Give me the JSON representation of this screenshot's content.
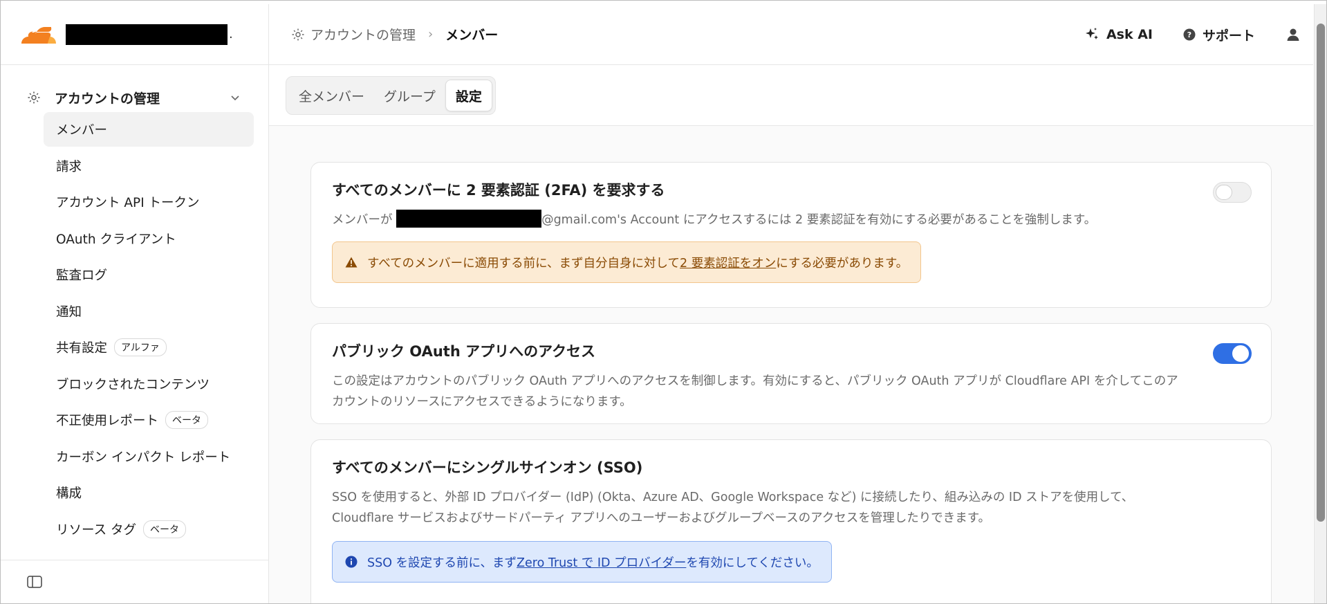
{
  "sidebar": {
    "account_suffix": ".",
    "group_label": "アカウントの管理",
    "items": [
      {
        "label": "メンバー",
        "badge": ""
      },
      {
        "label": "請求",
        "badge": ""
      },
      {
        "label": "アカウント API トークン",
        "badge": ""
      },
      {
        "label": "OAuth クライアント",
        "badge": ""
      },
      {
        "label": "監査ログ",
        "badge": ""
      },
      {
        "label": "通知",
        "badge": ""
      },
      {
        "label": "共有設定",
        "badge": "アルファ"
      },
      {
        "label": "ブロックされたコンテンツ",
        "badge": ""
      },
      {
        "label": "不正使用レポート",
        "badge": "ベータ"
      },
      {
        "label": "カーボン インパクト レポート",
        "badge": ""
      },
      {
        "label": "構成",
        "badge": ""
      },
      {
        "label": "リソース タグ",
        "badge": "ベータ"
      }
    ]
  },
  "breadcrumb": {
    "parent": "アカウントの管理",
    "separator": "›",
    "current": "メンバー"
  },
  "topbar": {
    "ask_ai": "Ask AI",
    "support": "サポート"
  },
  "tabs": [
    {
      "label": "全メンバー"
    },
    {
      "label": "グループ"
    },
    {
      "label": "設定"
    }
  ],
  "cards": {
    "twofa": {
      "title": "すべてのメンバーに 2 要素認証 (2FA) を要求する",
      "desc_prefix": "メンバーが ",
      "desc_suffix": "@gmail.com's Account にアクセスするには 2 要素認証を有効にする必要があることを強制します。",
      "warn_prefix": "すべてのメンバーに適用する前に、まず自分自身に対して ",
      "warn_link": "2 要素認証をオン",
      "warn_suffix": "にする必要があります。",
      "enabled": false
    },
    "oauth": {
      "title": "パブリック OAuth アプリへのアクセス",
      "desc": "この設定はアカウントのパブリック OAuth アプリへのアクセスを制御します。有効にすると、パブリック OAuth アプリが Cloudflare API を介してこのアカウントのリソースにアクセスできるようになります。",
      "enabled": true
    },
    "sso": {
      "title": "すべてのメンバーにシングルサインオン (SSO)",
      "desc": "SSO を使用すると、外部 ID プロバイダー (IdP) (Okta、Azure AD、Google Workspace など) に接続したり、組み込みの ID ストアを使用して、Cloudflare サービスおよびサードパーティ アプリへのユーザーおよびグループベースのアクセスを管理したりできます。",
      "info_prefix": "SSO を設定する前に、まず ",
      "info_link": "Zero Trust で ID プロバイダー",
      "info_suffix": "を有効にしてください。"
    }
  },
  "colors": {
    "brand": "#f38020",
    "toggle_on": "#2f6fe4",
    "warning_bg": "#fcebd4",
    "info_bg": "#dde9fd"
  },
  "icons": [
    "cloudflare-logo",
    "gear-icon",
    "chevron-down-icon",
    "sparkle-icon",
    "help-circle-icon",
    "user-icon",
    "warning-icon",
    "info-icon",
    "sidebar-toggle-icon"
  ]
}
